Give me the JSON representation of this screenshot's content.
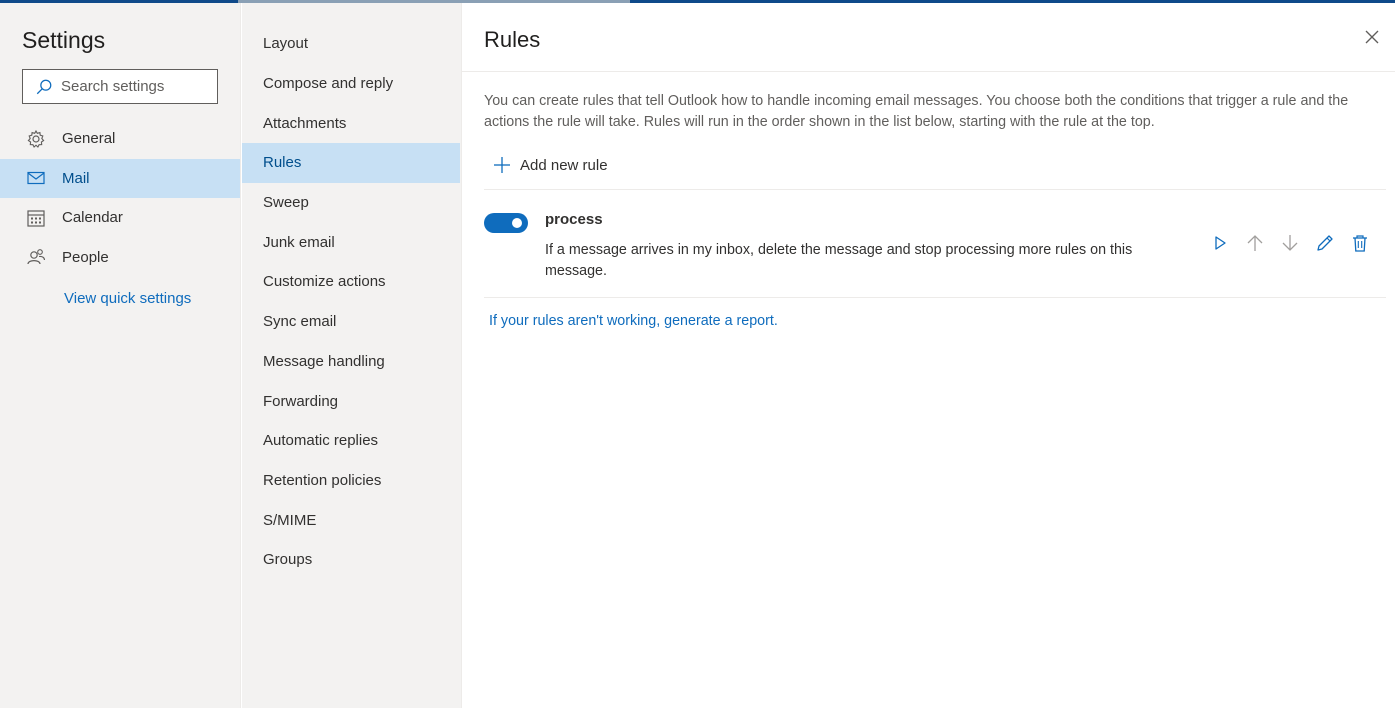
{
  "colors": {
    "accent": "#0f6cbd",
    "selected_bg": "#c7e0f4",
    "pane_bg": "#f3f2f1",
    "topbar": "#0f4a8a"
  },
  "settings": {
    "title": "Settings",
    "search_placeholder": "Search settings",
    "nav": [
      {
        "label": "General",
        "icon": "gear-icon",
        "selected": false
      },
      {
        "label": "Mail",
        "icon": "mail-icon",
        "selected": true
      },
      {
        "label": "Calendar",
        "icon": "calendar-icon",
        "selected": false
      },
      {
        "label": "People",
        "icon": "people-icon",
        "selected": false
      }
    ],
    "quick_settings_link": "View quick settings"
  },
  "mail_menu": {
    "items": [
      {
        "label": "Layout",
        "selected": false
      },
      {
        "label": "Compose and reply",
        "selected": false
      },
      {
        "label": "Attachments",
        "selected": false
      },
      {
        "label": "Rules",
        "selected": true
      },
      {
        "label": "Sweep",
        "selected": false
      },
      {
        "label": "Junk email",
        "selected": false
      },
      {
        "label": "Customize actions",
        "selected": false
      },
      {
        "label": "Sync email",
        "selected": false
      },
      {
        "label": "Message handling",
        "selected": false
      },
      {
        "label": "Forwarding",
        "selected": false
      },
      {
        "label": "Automatic replies",
        "selected": false
      },
      {
        "label": "Retention policies",
        "selected": false
      },
      {
        "label": "S/MIME",
        "selected": false
      },
      {
        "label": "Groups",
        "selected": false
      }
    ]
  },
  "rules": {
    "title": "Rules",
    "description": "You can create rules that tell Outlook how to handle incoming email messages. You choose both the conditions that trigger a rule and the actions the rule will take. Rules will run in the order shown in the list below, starting with the rule at the top.",
    "add_label": "Add new rule",
    "items": [
      {
        "name": "process",
        "enabled": true,
        "description": "If a message arrives in my inbox, delete the message and stop processing more rules on this message."
      }
    ],
    "report_link": "If your rules aren't working, generate a report."
  }
}
